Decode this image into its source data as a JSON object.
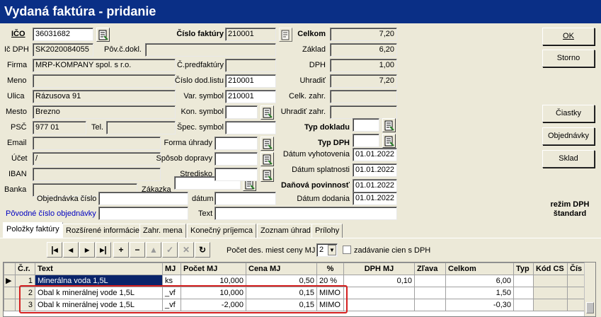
{
  "window": {
    "title": "Vydaná faktúra  -  pridanie"
  },
  "header": {
    "ico_label": "IČO",
    "ico_value": "36031682",
    "icdph_label": "Ič DPH",
    "icdph_value": "SK2020084055",
    "povcdokl_label": "Pôv.č.dokl.",
    "povcdokl_value": "",
    "firma_label": "Firma",
    "firma_value": "MRP-KOMPANY spol. s r.o.",
    "meno_label": "Meno",
    "meno_value": "",
    "ulica_label": "Ulica",
    "ulica_value": "Rázusova 91",
    "mesto_label": "Mesto",
    "mesto_value": "Brezno",
    "psc_label": "PSČ",
    "psc_value": "977 01",
    "tel_label": "Tel.",
    "tel_value": "",
    "email_label": "Email",
    "email_value": "",
    "ucet_label": "Účet",
    "ucet_value": "/",
    "iban_label": "IBAN",
    "iban_value": "",
    "banka_label": "Banka",
    "banka_value": "",
    "objednavka_label": "Objednávka číslo",
    "objednavka_value": "",
    "povodne_label": "Pôvodné číslo objednávky",
    "povodne_value": "",
    "cislo_faktury_label": "Číslo faktúry",
    "cislo_faktury_value": "210001",
    "predfaktury_label": "Č.predfaktúry",
    "predfaktury_value": "",
    "dodlistu_label": "Číslo dod.listu",
    "dodlistu_value": "210001",
    "var_symbol_label": "Var. symbol",
    "var_symbol_value": "210001",
    "kon_symbol_label": "Kon. symbol",
    "kon_symbol_value": "",
    "spec_symbol_label": "Špec. symbol",
    "spec_symbol_value": "",
    "forma_uhrady_label": "Forma úhrady",
    "forma_uhrady_value": "",
    "sposob_dopravy_label": "Spôsob dopravy",
    "sposob_dopravy_value": "",
    "stredisko_label": "Stredisko",
    "stredisko_value": "",
    "zakazka_label": "Zákazka",
    "zakazka_value": "",
    "datum_label": "dátum",
    "datum_value": "",
    "text_label": "Text",
    "text_value": ""
  },
  "summary": {
    "celkom_label": "Celkom",
    "celkom_value": "7,20",
    "zaklad_label": "Základ",
    "zaklad_value": "6,20",
    "dph_label": "DPH",
    "dph_value": "1,00",
    "uhradit_label": "Uhradiť",
    "uhradit_value": "7,20",
    "celk_zahr_label": "Celk. zahr.",
    "celk_zahr_value": "",
    "uhradit_zahr_label": "Uhradiť zahr.",
    "uhradit_zahr_value": "",
    "typ_dokladu_label": "Typ dokladu",
    "typ_dokladu_value": "",
    "typ_dph_label": "Typ DPH",
    "typ_dph_value": "",
    "datum_vyhotovenia_label": "Dátum vyhotovenia",
    "datum_vyhotovenia_value": "01.01.2022",
    "datum_splatnosti_label": "Dátum splatnosti",
    "datum_splatnosti_value": "01.01.2022",
    "danova_povinnost_label": "Daňová povinnosť",
    "danova_povinnost_value": "01.01.2022",
    "datum_dodania_label": "Dátum dodania",
    "datum_dodania_value": "01.01.2022"
  },
  "buttons": {
    "ok": "OK",
    "storno": "Storno",
    "ciastky": "Čiastky",
    "objednavky": "Objednávky",
    "sklad": "Sklad"
  },
  "rezim": {
    "line1": "režim DPH",
    "line2": "štandard"
  },
  "tabs": [
    "Položky faktúry",
    "Rozšírené informácie",
    "Zahr. mena",
    "Konečný príjemca",
    "Zoznam úhrad",
    "Prílohy"
  ],
  "toolbar": {
    "decimals_label": "Počet des. miest ceny MJ",
    "decimals_value": "2",
    "zadavanie_label": "zadávanie cien s DPH"
  },
  "grid": {
    "columns": [
      "Č.r.",
      "Text",
      "MJ",
      "Počet MJ",
      "Cena MJ",
      "%",
      "DPH MJ",
      "Zľava",
      "Celkom",
      "Typ",
      "Kód CS",
      "Čís"
    ],
    "rows": [
      [
        "1",
        "Minerálna voda 1,5L",
        "ks",
        "10,000",
        "0,50",
        "20 %",
        "0,10",
        "",
        "6,00",
        "",
        "",
        ""
      ],
      [
        "2",
        "Obal k minerálnej vode 1,5L",
        "_vf",
        "10,000",
        "0,15",
        "MIMO",
        "",
        "",
        "1,50",
        "",
        "",
        ""
      ],
      [
        "3",
        "Obal k minerálnej vode 1,5L",
        "_vf",
        "-2,000",
        "0,15",
        "MIMO",
        "",
        "",
        "-0,30",
        "",
        "",
        ""
      ]
    ]
  },
  "colors": {
    "titlebar": "#0a2f86",
    "highlight": "#d42020",
    "selected_cell": "#0a246a"
  }
}
